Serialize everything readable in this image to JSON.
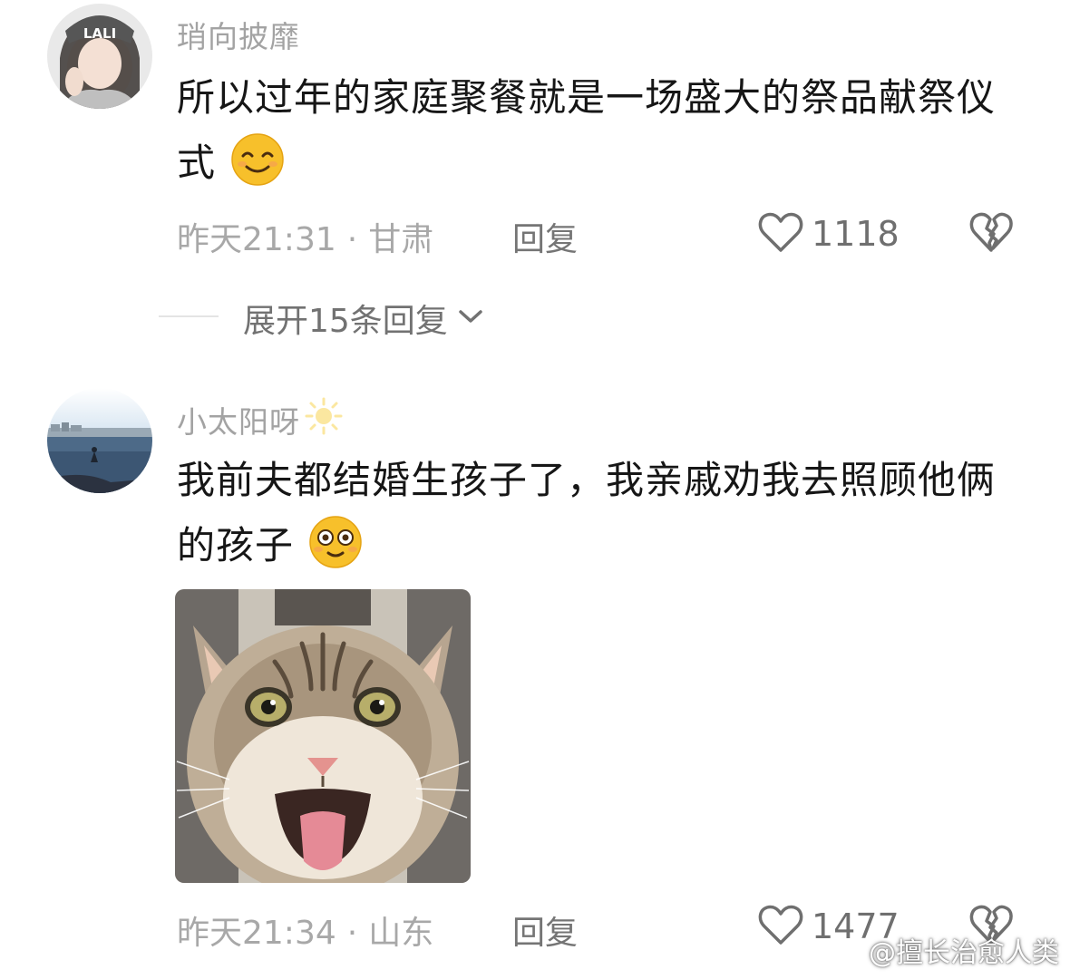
{
  "comments": [
    {
      "username": "琑向披靡",
      "text": "所以过年的家庭聚餐就是一场盛大的祭品献祭仪式",
      "emoji": "smile-emoji",
      "time": "昨天21:31",
      "separator": "·",
      "location": "甘肃",
      "reply_label": "回复",
      "likes": "1118",
      "avatar_text": "LALI"
    },
    {
      "username": "小太阳呀",
      "username_emoji": "sun-emoji",
      "text": "我前夫都结婚生孩子了，我亲戚劝我去照顾他俩的孩子",
      "emoji": "wide-eyed-emoji",
      "time": "昨天21:34",
      "separator": "·",
      "location": "山东",
      "reply_label": "回复",
      "likes": "1477"
    }
  ],
  "expand_replies": {
    "label": "展开15条回复",
    "icon": "chevron-down-icon"
  },
  "watermark": {
    "text": "@擅长治愈人类",
    "icon": "weibo-icon"
  },
  "colors": {
    "username": "#a3a3a3",
    "meta": "#a8a8a8",
    "text": "#161616",
    "emoji": "#f7c02b"
  }
}
